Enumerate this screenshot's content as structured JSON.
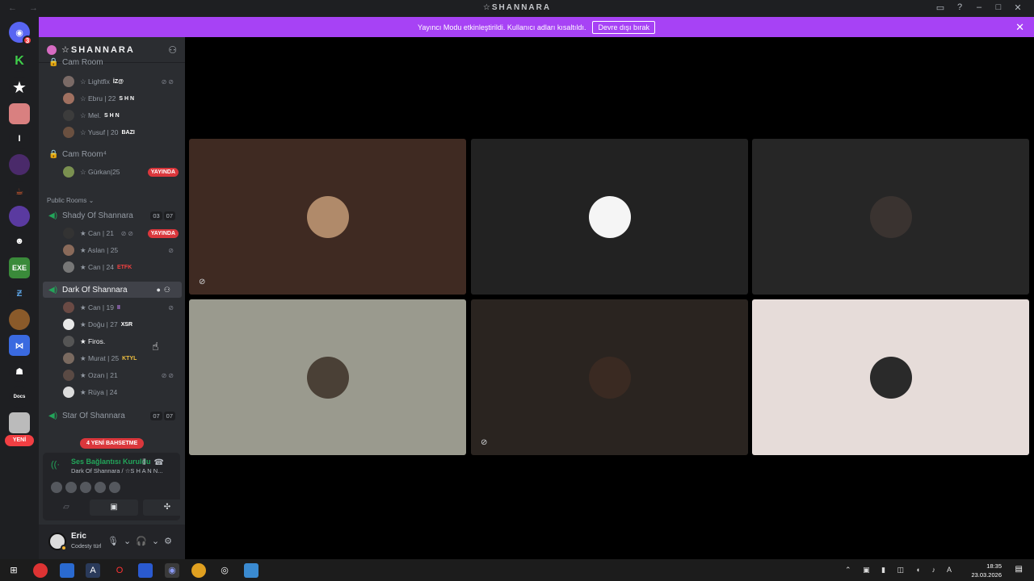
{
  "window": {
    "title": "☆SHANNARA",
    "controls": [
      "▭",
      "?",
      "–",
      "□",
      "✕"
    ]
  },
  "banner": {
    "text": "Yayıncı Modu etkinleştirildi. Kullanıcı adları kısaltıldı.",
    "button": "Devre dışı bırak"
  },
  "guild": {
    "name": "☆SHANNARA"
  },
  "servers": {
    "badge": "3",
    "new_label": "YENİ"
  },
  "channels": {
    "top_channel_partial": "Cam Room",
    "cam_room_members": [
      {
        "name": "☆ Lightfix",
        "tag": "İZ@",
        "flags": "⊘⊘",
        "color": "#7a6a66"
      },
      {
        "name": "☆ Ebru | 22",
        "tag": "S H N",
        "flags": "",
        "color": "#a07060"
      },
      {
        "name": "☆ Mel.",
        "tag": "S H N",
        "flags": "",
        "color": "#3c3c3c"
      },
      {
        "name": "☆ Yusuf | 20",
        "tag": "BAZI",
        "flags": "",
        "color": "#6a5040"
      }
    ],
    "cam_room4": {
      "name": "Cam Room⁴"
    },
    "cam_room4_members": [
      {
        "name": "☆ Gürkan|25",
        "live": "YAYINDA",
        "color": "#7a9050"
      }
    ],
    "category": "Public Rooms",
    "shady": {
      "name": "Shady Of Shannara",
      "count_a": "03",
      "count_b": "07"
    },
    "shady_members": [
      {
        "name": "★ Can | 21",
        "flags": "⊘⊘",
        "live": "YAYINDA",
        "color": "#333"
      },
      {
        "name": "★ Aslan | 25",
        "flags": "⊘",
        "color": "#8a6a5a"
      },
      {
        "name": "★ Can | 24",
        "tag": "ETFK",
        "flags": "",
        "color": "#777"
      }
    ],
    "dark": {
      "name": "Dark Of Shannara"
    },
    "dark_members": [
      {
        "name": "★ Can | 19",
        "tag": "II",
        "flags": "⊘",
        "color": "#6a4a44"
      },
      {
        "name": "★ Doğu | 27",
        "tag": "XSR",
        "flags": "",
        "color": "#e8e8e8"
      },
      {
        "name": "★ Firos.",
        "tag": "",
        "flags": "",
        "color": "#555"
      },
      {
        "name": "★ Murat | 25",
        "tag": "KTYL",
        "flags": "",
        "color": "#7a6a60"
      },
      {
        "name": "★ Ozan | 21",
        "tag": "",
        "flags": "⊘⊘",
        "color": "#5a4a44"
      },
      {
        "name": "★ Rüya | 24",
        "tag": "",
        "flags": "",
        "color": "#dcdcdc"
      }
    ],
    "star": {
      "name": "Star Of Shannara",
      "count_a": "07",
      "count_b": "07"
    },
    "mention_pill": "4 YENİ BAHSETME"
  },
  "voice": {
    "status": "Ses Bağlantısı Kuruldu",
    "sub": "Dark Of Shannara / ☆S H A N N...",
    "btn_camera": "▱",
    "btn_screen": "▣",
    "btn_activity": "✣"
  },
  "user": {
    "name": "Eric",
    "status": "Codesty türl"
  },
  "tiles": [
    {
      "bg": "#3f2a22",
      "face": "#b08a6a",
      "muted": "⊘"
    },
    {
      "bg": "#222222",
      "face": "#f5f5f5",
      "muted": ""
    },
    {
      "bg": "#262626",
      "face": "#3a3330",
      "muted": ""
    },
    {
      "bg": "#9a9a8e",
      "face": "#4a4036",
      "muted": ""
    },
    {
      "bg": "#2a2420",
      "face": "#3a2a22",
      "muted": "⊘"
    },
    {
      "bg": "#e6dcd9",
      "face": "#2a2a2a",
      "muted": ""
    }
  ],
  "taskbar": {
    "time": "18:35",
    "date": "23.03.2026"
  }
}
